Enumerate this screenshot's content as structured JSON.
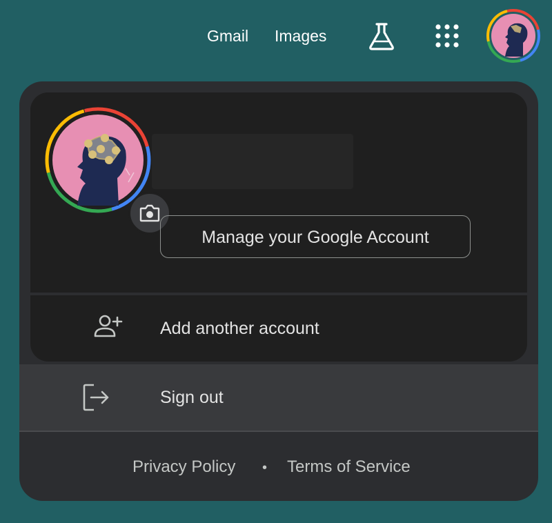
{
  "topbar": {
    "gmail_label": "Gmail",
    "images_label": "Images",
    "labs_icon": "flask-icon",
    "apps_icon": "grid-dots-icon",
    "avatar_icon": "avatar-head-icon"
  },
  "account": {
    "camera_icon": "camera-icon",
    "manage_label": "Manage your Google Account"
  },
  "menu": {
    "add_account_label": "Add another account",
    "add_account_icon": "person-add-icon",
    "sign_out_label": "Sign out",
    "sign_out_icon": "logout-icon"
  },
  "footer": {
    "privacy_label": "Privacy Policy",
    "separator": "•",
    "terms_label": "Terms of Service"
  },
  "colors": {
    "background": "#215f63",
    "panel": "#2c2d30",
    "card": "#1f1f1f",
    "hover_row": "#393a3d",
    "ring_red": "#ea4335",
    "ring_blue": "#4285f4",
    "ring_yellow": "#fbbc04",
    "ring_green": "#34a853",
    "avatar_pink": "#e78fb3",
    "avatar_navy": "#1e2a52"
  }
}
